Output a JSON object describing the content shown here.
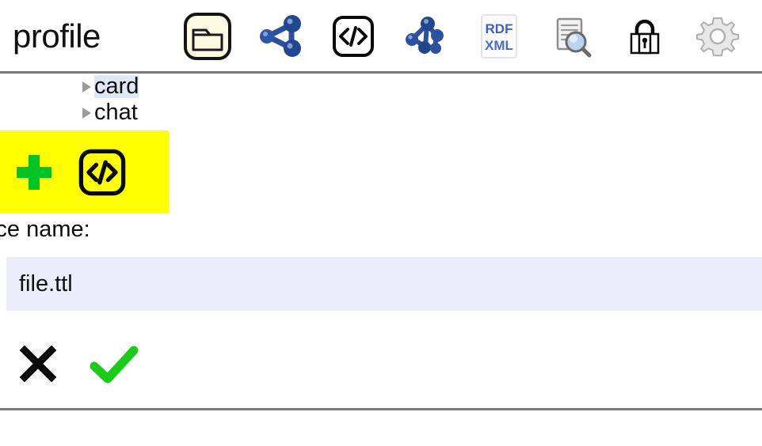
{
  "window": {
    "title": "profile",
    "background_color": "#ffffff"
  },
  "header": {
    "title": "profile",
    "toolbar": {
      "buttons": [
        {
          "name": "folder-icon",
          "label": "Open folder",
          "icon": "folder-icon",
          "badge_color": "#fbfbe2"
        },
        {
          "name": "graph-simple-icon",
          "label": "Graph view",
          "icon": "graph-node-icon",
          "badge_color": "#2d4f9e"
        },
        {
          "name": "code-icon",
          "label": "Source code view",
          "icon": "code-brackets-icon",
          "badge_color": "#000000"
        },
        {
          "name": "graph-complex-icon",
          "label": "Full graph view",
          "icon": "graph-cluster-icon",
          "badge_color": "#2d4f9e"
        },
        {
          "name": "rdf-xml-icon",
          "label": "RDF/XML",
          "icon": "rdf-xml-icon",
          "badge_color": "#3f5fc0"
        },
        {
          "name": "preview-icon",
          "label": "Preview document",
          "icon": "document-search-icon",
          "badge_color": "#6f9fd8"
        },
        {
          "name": "lock-icon",
          "label": "Permissions",
          "icon": "padlock-icon",
          "badge_color": "#000000"
        },
        {
          "name": "settings-icon",
          "label": "Settings",
          "icon": "gear-icon",
          "badge_color": "#b5b5b5"
        }
      ]
    },
    "rdf_xml_text": {
      "line1": "RDF",
      "line2": "XML"
    }
  },
  "tree": {
    "items": [
      {
        "label": "card",
        "expander": "collapsed-triangle",
        "selected": true
      },
      {
        "label": "chat",
        "expander": "collapsed-triangle",
        "selected": false
      }
    ]
  },
  "action_bar": {
    "highlight_color": "#ffff00",
    "buttons": [
      {
        "name": "add-resource-button",
        "label": "Add",
        "icon": "plus-icon",
        "color": "#00c426"
      },
      {
        "name": "add-source-button",
        "label": "Add source",
        "icon": "code-brackets-icon",
        "color": "#000000"
      }
    ]
  },
  "form": {
    "label": "source name:",
    "input": {
      "value": "file.ttl",
      "placeholder": "",
      "background_color": "#ececfb"
    }
  },
  "confirm": {
    "buttons": [
      {
        "name": "cancel-button",
        "label": "Cancel",
        "icon": "cross-icon",
        "color": "#000000"
      },
      {
        "name": "confirm-button",
        "label": "Confirm",
        "icon": "check-icon",
        "color": "#18cc18"
      }
    ]
  },
  "colors": {
    "rule": "#7a7a7a",
    "highlight": "#ffff00",
    "input_bg": "#ececfb",
    "accent_green": "#00c426",
    "accent_blue": "#2d4f9e"
  }
}
